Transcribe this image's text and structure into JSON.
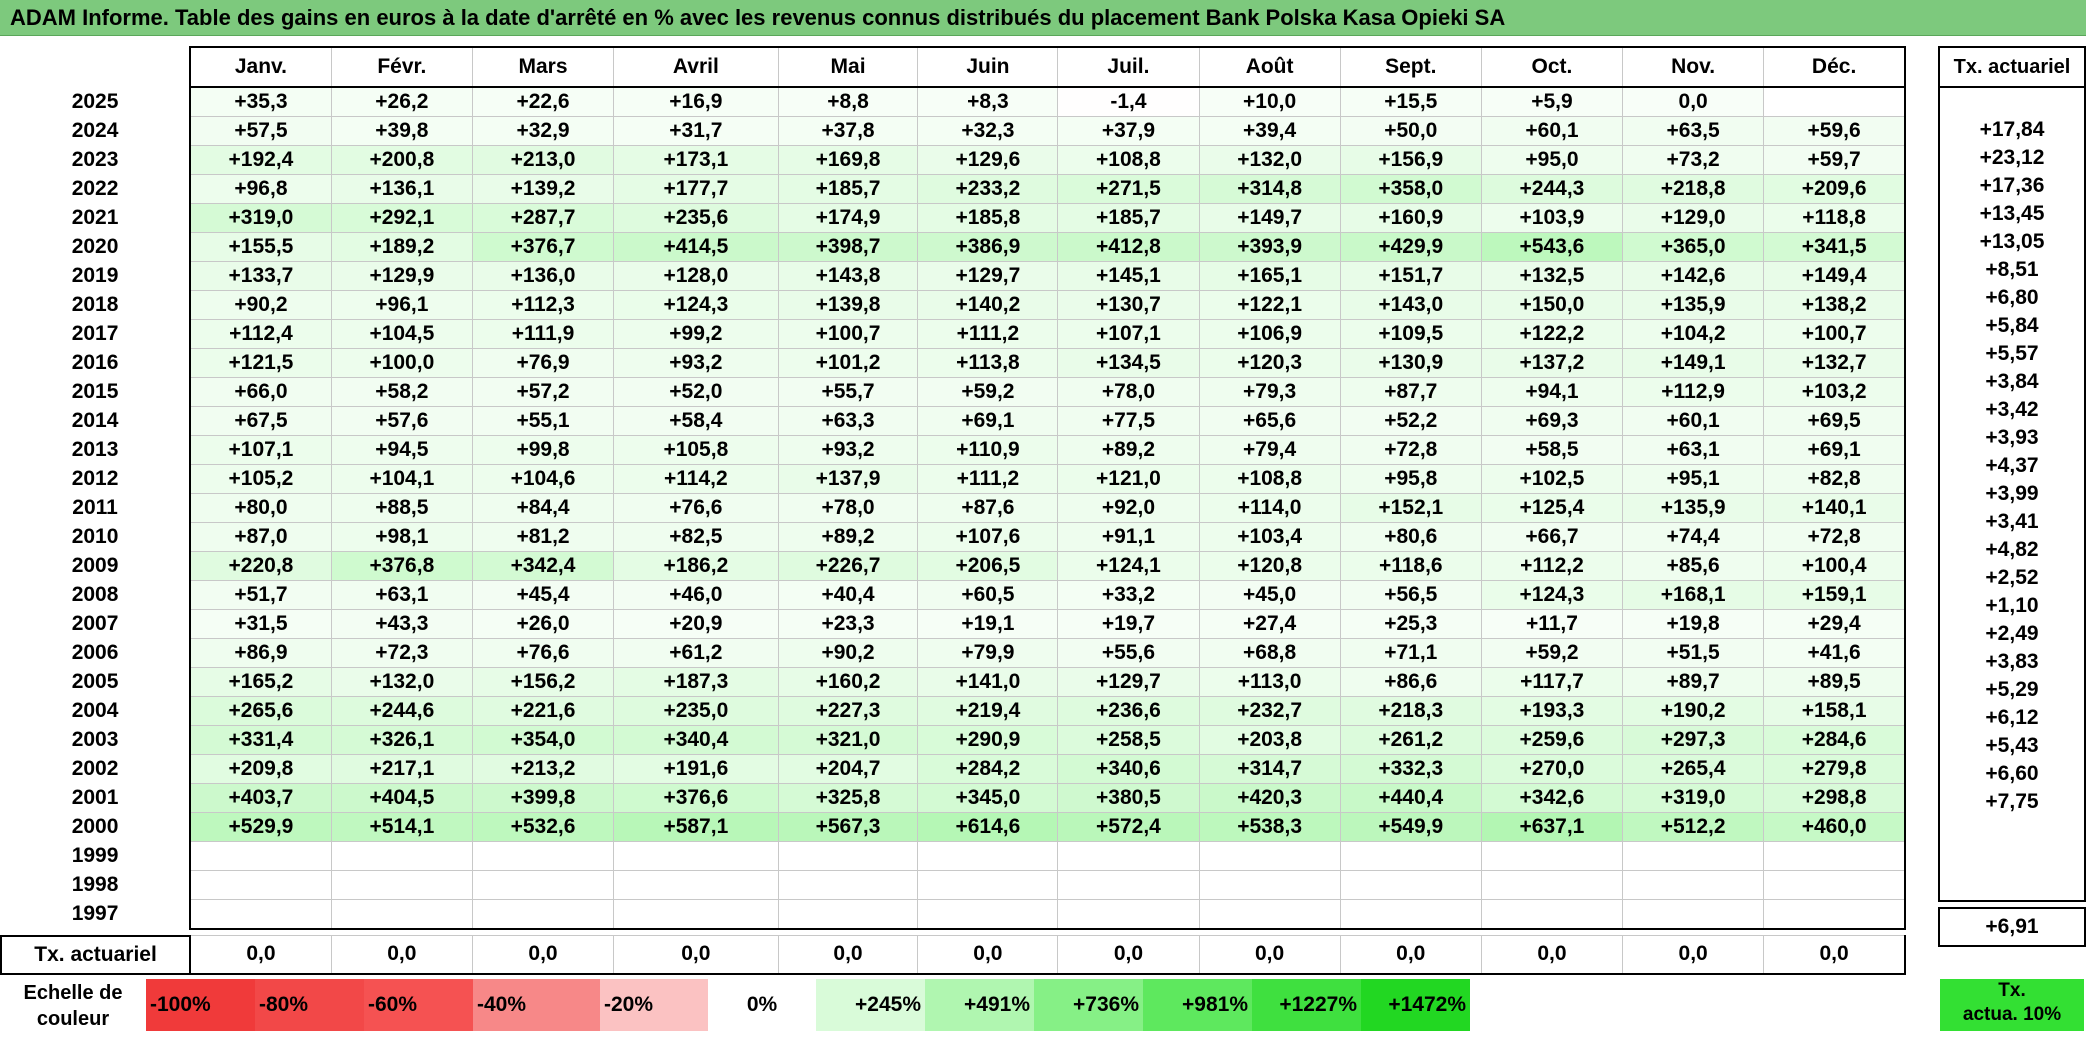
{
  "title": "ADAM Informe. Table des gains en euros à la date d'arrêté en % avec les revenus connus distribués du placement Bank Polska Kasa Opieki SA",
  "months": [
    "Janv.",
    "Févr.",
    "Mars",
    "Avril",
    "Mai",
    "Juin",
    "Juil.",
    "Août",
    "Sept.",
    "Oct.",
    "Nov.",
    "Déc."
  ],
  "right_header": "Tx. actuariel",
  "rows": [
    {
      "year": "2025",
      "values": [
        "+35,3",
        "+26,2",
        "+22,6",
        "+16,9",
        "+8,8",
        "+8,3",
        "-1,4",
        "+10,0",
        "+15,5",
        "+5,9",
        "0,0",
        ""
      ],
      "rate": ""
    },
    {
      "year": "2024",
      "values": [
        "+57,5",
        "+39,8",
        "+32,9",
        "+31,7",
        "+37,8",
        "+32,3",
        "+37,9",
        "+39,4",
        "+50,0",
        "+60,1",
        "+63,5",
        "+59,6"
      ],
      "rate": "+17,84"
    },
    {
      "year": "2023",
      "values": [
        "+192,4",
        "+200,8",
        "+213,0",
        "+173,1",
        "+169,8",
        "+129,6",
        "+108,8",
        "+132,0",
        "+156,9",
        "+95,0",
        "+73,2",
        "+59,7"
      ],
      "rate": "+23,12"
    },
    {
      "year": "2022",
      "values": [
        "+96,8",
        "+136,1",
        "+139,2",
        "+177,7",
        "+185,7",
        "+233,2",
        "+271,5",
        "+314,8",
        "+358,0",
        "+244,3",
        "+218,8",
        "+209,6"
      ],
      "rate": "+17,36"
    },
    {
      "year": "2021",
      "values": [
        "+319,0",
        "+292,1",
        "+287,7",
        "+235,6",
        "+174,9",
        "+185,8",
        "+185,7",
        "+149,7",
        "+160,9",
        "+103,9",
        "+129,0",
        "+118,8"
      ],
      "rate": "+13,45"
    },
    {
      "year": "2020",
      "values": [
        "+155,5",
        "+189,2",
        "+376,7",
        "+414,5",
        "+398,7",
        "+386,9",
        "+412,8",
        "+393,9",
        "+429,9",
        "+543,6",
        "+365,0",
        "+341,5"
      ],
      "rate": "+13,05"
    },
    {
      "year": "2019",
      "values": [
        "+133,7",
        "+129,9",
        "+136,0",
        "+128,0",
        "+143,8",
        "+129,7",
        "+145,1",
        "+165,1",
        "+151,7",
        "+132,5",
        "+142,6",
        "+149,4"
      ],
      "rate": "+8,51"
    },
    {
      "year": "2018",
      "values": [
        "+90,2",
        "+96,1",
        "+112,3",
        "+124,3",
        "+139,8",
        "+140,2",
        "+130,7",
        "+122,1",
        "+143,0",
        "+150,0",
        "+135,9",
        "+138,2"
      ],
      "rate": "+6,80"
    },
    {
      "year": "2017",
      "values": [
        "+112,4",
        "+104,5",
        "+111,9",
        "+99,2",
        "+100,7",
        "+111,2",
        "+107,1",
        "+106,9",
        "+109,5",
        "+122,2",
        "+104,2",
        "+100,7"
      ],
      "rate": "+5,84"
    },
    {
      "year": "2016",
      "values": [
        "+121,5",
        "+100,0",
        "+76,9",
        "+93,2",
        "+101,2",
        "+113,8",
        "+134,5",
        "+120,3",
        "+130,9",
        "+137,2",
        "+149,1",
        "+132,7"
      ],
      "rate": "+5,57"
    },
    {
      "year": "2015",
      "values": [
        "+66,0",
        "+58,2",
        "+57,2",
        "+52,0",
        "+55,7",
        "+59,2",
        "+78,0",
        "+79,3",
        "+87,7",
        "+94,1",
        "+112,9",
        "+103,2"
      ],
      "rate": "+3,84"
    },
    {
      "year": "2014",
      "values": [
        "+67,5",
        "+57,6",
        "+55,1",
        "+58,4",
        "+63,3",
        "+69,1",
        "+77,5",
        "+65,6",
        "+52,2",
        "+69,3",
        "+60,1",
        "+69,5"
      ],
      "rate": "+3,42"
    },
    {
      "year": "2013",
      "values": [
        "+107,1",
        "+94,5",
        "+99,8",
        "+105,8",
        "+93,2",
        "+110,9",
        "+89,2",
        "+79,4",
        "+72,8",
        "+58,5",
        "+63,1",
        "+69,1"
      ],
      "rate": "+3,93"
    },
    {
      "year": "2012",
      "values": [
        "+105,2",
        "+104,1",
        "+104,6",
        "+114,2",
        "+137,9",
        "+111,2",
        "+121,0",
        "+108,8",
        "+95,8",
        "+102,5",
        "+95,1",
        "+82,8"
      ],
      "rate": "+4,37"
    },
    {
      "year": "2011",
      "values": [
        "+80,0",
        "+88,5",
        "+84,4",
        "+76,6",
        "+78,0",
        "+87,6",
        "+92,0",
        "+114,0",
        "+152,1",
        "+125,4",
        "+135,9",
        "+140,1"
      ],
      "rate": "+3,99"
    },
    {
      "year": "2010",
      "values": [
        "+87,0",
        "+98,1",
        "+81,2",
        "+82,5",
        "+89,2",
        "+107,6",
        "+91,1",
        "+103,4",
        "+80,6",
        "+66,7",
        "+74,4",
        "+72,8"
      ],
      "rate": "+3,41"
    },
    {
      "year": "2009",
      "values": [
        "+220,8",
        "+376,8",
        "+342,4",
        "+186,2",
        "+226,7",
        "+206,5",
        "+124,1",
        "+120,8",
        "+118,6",
        "+112,2",
        "+85,6",
        "+100,4"
      ],
      "rate": "+4,82"
    },
    {
      "year": "2008",
      "values": [
        "+51,7",
        "+63,1",
        "+45,4",
        "+46,0",
        "+40,4",
        "+60,5",
        "+33,2",
        "+45,0",
        "+56,5",
        "+124,3",
        "+168,1",
        "+159,1"
      ],
      "rate": "+2,52"
    },
    {
      "year": "2007",
      "values": [
        "+31,5",
        "+43,3",
        "+26,0",
        "+20,9",
        "+23,3",
        "+19,1",
        "+19,7",
        "+27,4",
        "+25,3",
        "+11,7",
        "+19,8",
        "+29,4"
      ],
      "rate": "+1,10"
    },
    {
      "year": "2006",
      "values": [
        "+86,9",
        "+72,3",
        "+76,6",
        "+61,2",
        "+90,2",
        "+79,9",
        "+55,6",
        "+68,8",
        "+71,1",
        "+59,2",
        "+51,5",
        "+41,6"
      ],
      "rate": "+2,49"
    },
    {
      "year": "2005",
      "values": [
        "+165,2",
        "+132,0",
        "+156,2",
        "+187,3",
        "+160,2",
        "+141,0",
        "+129,7",
        "+113,0",
        "+86,6",
        "+117,7",
        "+89,7",
        "+89,5"
      ],
      "rate": "+3,83"
    },
    {
      "year": "2004",
      "values": [
        "+265,6",
        "+244,6",
        "+221,6",
        "+235,0",
        "+227,3",
        "+219,4",
        "+236,6",
        "+232,7",
        "+218,3",
        "+193,3",
        "+190,2",
        "+158,1"
      ],
      "rate": "+5,29"
    },
    {
      "year": "2003",
      "values": [
        "+331,4",
        "+326,1",
        "+354,0",
        "+340,4",
        "+321,0",
        "+290,9",
        "+258,5",
        "+203,8",
        "+261,2",
        "+259,6",
        "+297,3",
        "+284,6"
      ],
      "rate": "+6,12"
    },
    {
      "year": "2002",
      "values": [
        "+209,8",
        "+217,1",
        "+213,2",
        "+191,6",
        "+204,7",
        "+284,2",
        "+340,6",
        "+314,7",
        "+332,3",
        "+270,0",
        "+265,4",
        "+279,8"
      ],
      "rate": "+5,43"
    },
    {
      "year": "2001",
      "values": [
        "+403,7",
        "+404,5",
        "+399,8",
        "+376,6",
        "+325,8",
        "+345,0",
        "+380,5",
        "+420,3",
        "+440,4",
        "+342,6",
        "+319,0",
        "+298,8"
      ],
      "rate": "+6,60"
    },
    {
      "year": "2000",
      "values": [
        "+529,9",
        "+514,1",
        "+532,6",
        "+587,1",
        "+567,3",
        "+614,6",
        "+572,4",
        "+538,3",
        "+549,9",
        "+637,1",
        "+512,2",
        "+460,0"
      ],
      "rate": "+7,75"
    },
    {
      "year": "1999",
      "values": [
        "",
        "",
        "",
        "",
        "",
        "",
        "",
        "",
        "",
        "",
        "",
        ""
      ],
      "rate": ""
    },
    {
      "year": "1998",
      "values": [
        "",
        "",
        "",
        "",
        "",
        "",
        "",
        "",
        "",
        "",
        "",
        ""
      ],
      "rate": ""
    },
    {
      "year": "1997",
      "values": [
        "",
        "",
        "",
        "",
        "",
        "",
        "",
        "",
        "",
        "",
        "",
        ""
      ],
      "rate": ""
    }
  ],
  "totals": {
    "label": "Tx. actuariel",
    "values": [
      "0,0",
      "0,0",
      "0,0",
      "0,0",
      "0,0",
      "0,0",
      "0,0",
      "0,0",
      "0,0",
      "0,0",
      "0,0",
      "0,0"
    ],
    "rate": "+6,91"
  },
  "scale": {
    "label": "Echelle de couleur",
    "items": [
      {
        "label": "-100%",
        "color": "#f03a3a",
        "kind": "neg"
      },
      {
        "label": "-80%",
        "color": "#f24848",
        "kind": "neg"
      },
      {
        "label": "-60%",
        "color": "#f55252",
        "kind": "neg"
      },
      {
        "label": "-40%",
        "color": "#f78888",
        "kind": "neg"
      },
      {
        "label": "-20%",
        "color": "#fbc2c2",
        "kind": "neg"
      },
      {
        "label": "0%",
        "color": "#ffffff",
        "kind": "zero"
      },
      {
        "label": "+245%",
        "color": "#d9fbd9",
        "kind": "pos"
      },
      {
        "label": "+491%",
        "color": "#b0f6b0",
        "kind": "pos"
      },
      {
        "label": "+736%",
        "color": "#86f086",
        "kind": "pos"
      },
      {
        "label": "+981%",
        "color": "#5ee85e",
        "kind": "pos"
      },
      {
        "label": "+1227%",
        "color": "#3fe03f",
        "kind": "pos"
      },
      {
        "label": "+1472%",
        "color": "#22d722",
        "kind": "pos"
      }
    ],
    "right_label": "Tx. actua. 10%"
  }
}
